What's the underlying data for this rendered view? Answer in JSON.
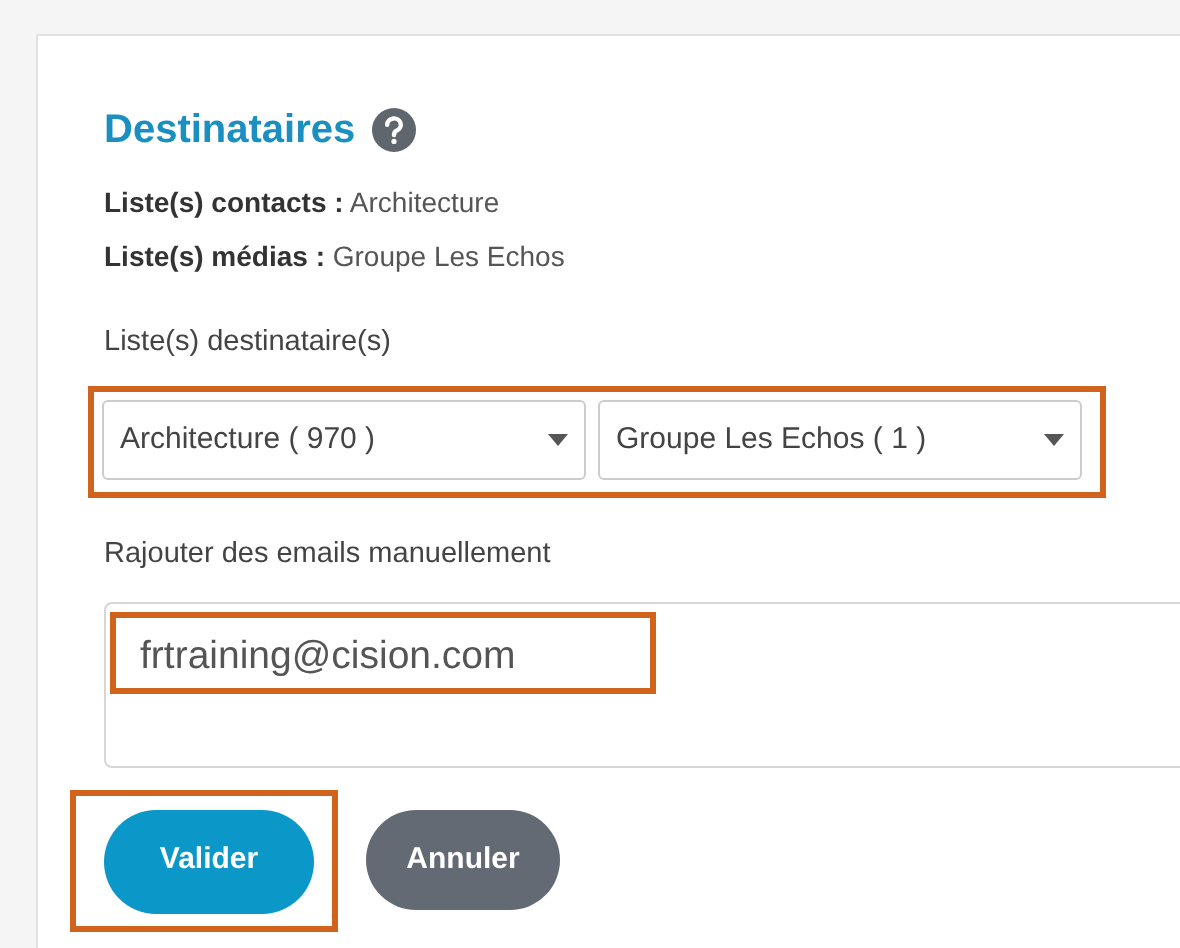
{
  "section": {
    "title": "Destinataires",
    "summary": [
      {
        "label": "Liste(s) contacts :",
        "value": "Architecture"
      },
      {
        "label": "Liste(s) médias :",
        "value": "Groupe Les Echos"
      }
    ]
  },
  "recipient_lists": {
    "label": "Liste(s) destinataire(s)",
    "highlighted": true,
    "selects": [
      {
        "value": "Architecture ( 970 )"
      },
      {
        "value": "Groupe Les Echos ( 1 )"
      }
    ]
  },
  "manual_emails": {
    "label": "Rajouter des emails manuellement",
    "value": "frtraining@cision.com",
    "highlighted": true
  },
  "buttons": [
    {
      "label": "Valider",
      "kind": "primary",
      "highlighted": true
    },
    {
      "label": "Annuler",
      "kind": "secondary",
      "highlighted": false
    }
  ]
}
